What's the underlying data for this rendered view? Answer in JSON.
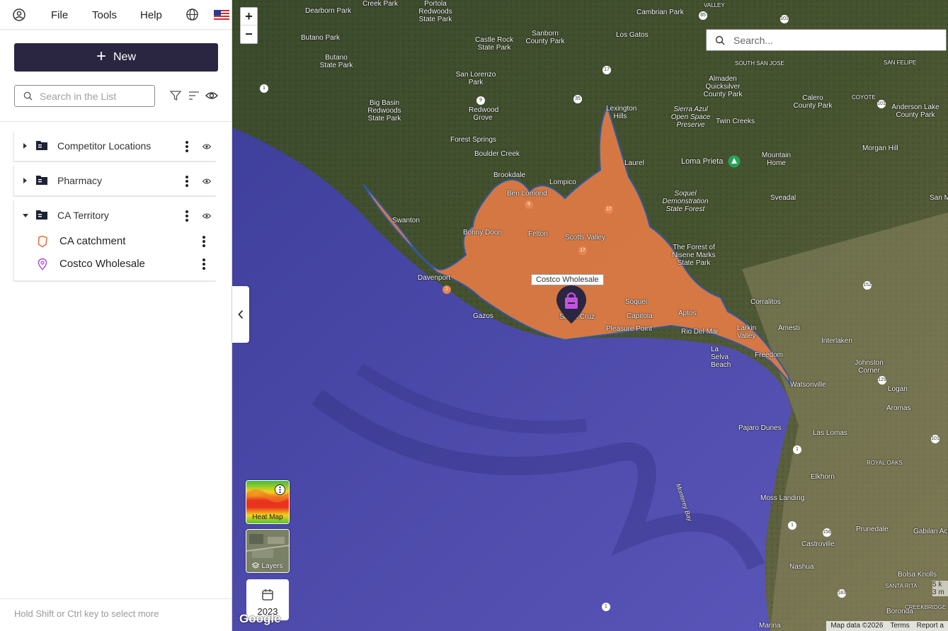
{
  "menubar": {
    "items": [
      "File",
      "Tools",
      "Help"
    ]
  },
  "toolbar": {
    "new_label": "New",
    "search_placeholder": "Search in the List"
  },
  "layers": {
    "folders": [
      {
        "label": "Competitor Locations",
        "expanded": false
      },
      {
        "label": "Pharmacy",
        "expanded": false
      },
      {
        "label": "CA Territory",
        "expanded": true
      }
    ],
    "children": [
      {
        "label": "CA catchment",
        "icon": "polygon-icon",
        "color": "#e0703a"
      },
      {
        "label": "Costco Wholesale",
        "icon": "location-pin-icon",
        "color": "#b048d8"
      }
    ]
  },
  "footer": {
    "hint": "Hold Shift or Ctrl key to select more"
  },
  "map": {
    "search_placeholder": "Search...",
    "zoom_in": "+",
    "zoom_out": "−",
    "pin_label": "Costco Wholesale",
    "heatmap_label": "Heat Map",
    "layers_label": "Layers",
    "year": "2023",
    "google": "Google",
    "attribution": {
      "data": "Map data ©2026",
      "terms": "Terms",
      "report": "Report a"
    },
    "scale": [
      "5 k",
      "3 m"
    ],
    "colors": {
      "catchment_fill": "#dd7a45",
      "catchment_stroke": "#2f5aa8",
      "ocean": "#4a4aa6",
      "land": "#3c4a2c"
    },
    "places": [
      {
        "text": "Creek Park"
      },
      {
        "text": "Portola Redwoods State Park"
      },
      {
        "text": "Dearborn Park"
      },
      {
        "text": "Cambrian Park"
      },
      {
        "text": "VALLEY"
      },
      {
        "text": "Sanborn County Park"
      },
      {
        "text": "Castle Rock State Park"
      },
      {
        "text": "Los Gatos"
      },
      {
        "text": "Butano Park"
      },
      {
        "text": "Butano State Park"
      },
      {
        "text": "SOUTH SAN JOSE"
      },
      {
        "text": "SAN FELIPE"
      },
      {
        "text": "San Lorenzo Park"
      },
      {
        "text": "Almaden Quicksilver County Park"
      },
      {
        "text": "Big Basin Redwoods State Park"
      },
      {
        "text": "Redwood Grove"
      },
      {
        "text": "Calero County Park"
      },
      {
        "text": "COYOTE"
      },
      {
        "text": "Lexington Hills"
      },
      {
        "text": "Sierra Azul Open Space Preserve"
      },
      {
        "text": "Anderson Lake County Park"
      },
      {
        "text": "Twin Creeks"
      },
      {
        "text": "Forest Springs"
      },
      {
        "text": "Boulder Creek"
      },
      {
        "text": "Morgan Hill"
      },
      {
        "text": "Laurel"
      },
      {
        "text": "Loma Prieta"
      },
      {
        "text": "Mountain Home"
      },
      {
        "text": "Brookdale"
      },
      {
        "text": "Lompico"
      },
      {
        "text": "Ben Lomond"
      },
      {
        "text": "Soquel Demonstration State Forest"
      },
      {
        "text": "Sveadal"
      },
      {
        "text": "San Mart"
      },
      {
        "text": "Swanton"
      },
      {
        "text": "Bonny Doon"
      },
      {
        "text": "Felton"
      },
      {
        "text": "Scotts Valley"
      },
      {
        "text": "The Forest of Nisene Marks State Park"
      },
      {
        "text": "Davenport"
      },
      {
        "text": "Corralitos"
      },
      {
        "text": "Amesti"
      },
      {
        "text": "Soquel"
      },
      {
        "text": "Capitola"
      },
      {
        "text": "Aptos"
      },
      {
        "text": "Gazos"
      },
      {
        "text": "Santa Cruz"
      },
      {
        "text": "Pleasure Point"
      },
      {
        "text": "Rio Del Mar"
      },
      {
        "text": "Larkin Valley"
      },
      {
        "text": "Interlaken"
      },
      {
        "text": "La Selva Beach"
      },
      {
        "text": "Freedom"
      },
      {
        "text": "Johnston Corner"
      },
      {
        "text": "Watsonville"
      },
      {
        "text": "Logan"
      },
      {
        "text": "Aromas"
      },
      {
        "text": "Pajaro Dunes"
      },
      {
        "text": "Las Lomas"
      },
      {
        "text": "ROYAL OAKS"
      },
      {
        "text": "Elkhorn"
      },
      {
        "text": "Moss Landing"
      },
      {
        "text": "Monterey Bay"
      },
      {
        "text": "Prunedale"
      },
      {
        "text": "Castroville"
      },
      {
        "text": "Gabilan Acres"
      },
      {
        "text": "Nashua"
      },
      {
        "text": "Bolsa Knolls"
      },
      {
        "text": "SANTA RITA"
      },
      {
        "text": "CREEKBRIDGE"
      },
      {
        "text": "Boronda"
      },
      {
        "text": "Marina"
      }
    ],
    "shields": [
      "85",
      "101",
      "17",
      "1",
      "35",
      "9",
      "101",
      "152",
      "129",
      "156",
      "183",
      "1",
      "1",
      "1",
      "17",
      "1",
      "9",
      "17",
      "101"
    ]
  }
}
